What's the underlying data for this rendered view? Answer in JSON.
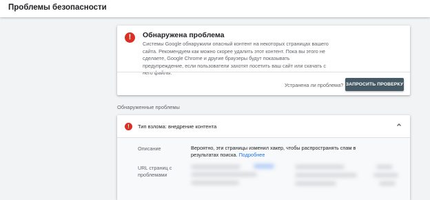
{
  "header": {
    "title": "Проблемы безопасности"
  },
  "alert": {
    "icon": "exclamation-icon",
    "title": "Обнаружена проблема",
    "text": "Системы Google обнаружили опасный контент на некоторых страницах вашего сайта. Рекомендуем как можно скорее удалить этот контент. Пока вы этого не сделаете, Google Chrome и другие браузеры будут показывать предупреждение, если пользователи захотят посетить ваш сайт или скачать с него файлы.",
    "fixed_question": "Устранена ли проблема?",
    "request_button": "ЗАПРОСИТЬ ПРОВЕРКУ"
  },
  "issues_section": {
    "label": "Обнаруженные проблемы",
    "issue": {
      "icon": "exclamation-icon",
      "title": "Тип взлома: внедрение контента",
      "expanded": true,
      "description_label": "Описание",
      "description_text": "Вероятно, эти страницы изменил хакер, чтобы распространять спам в результатах поиска.",
      "more_link": "Подробнее",
      "url_label": "URL страниц с проблемами"
    }
  },
  "colors": {
    "error": "#d93025",
    "button": "#455a64",
    "link": "#1a73e8"
  }
}
